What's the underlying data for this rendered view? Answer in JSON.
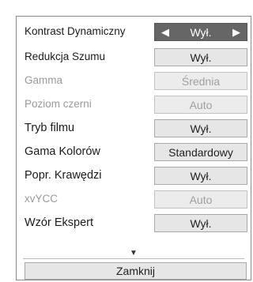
{
  "menu": {
    "rows": [
      {
        "label": "Kontrast Dynamiczny",
        "value": "Wył.",
        "state": "selected"
      },
      {
        "label": "Redukcja Szumu",
        "value": "Wył.",
        "state": "normal"
      },
      {
        "label": "Gamma",
        "value": "Średnia",
        "state": "disabled"
      },
      {
        "label": "Poziom czerni",
        "value": "Auto",
        "state": "disabled"
      },
      {
        "label": "Tryb filmu",
        "value": "Wył.",
        "state": "normal"
      },
      {
        "label": "Gama Kolorów",
        "value": "Standardowy",
        "state": "normal"
      },
      {
        "label": "Popr. Krawędzi",
        "value": "Wył.",
        "state": "normal"
      },
      {
        "label": "xvYCC",
        "value": "Auto",
        "state": "disabled"
      },
      {
        "label": "Wzór Ekspert",
        "value": "Wył.",
        "state": "normal"
      }
    ],
    "left_arrow": "◀",
    "right_arrow": "▶",
    "scroll_down": "▼",
    "close_label": "Zamknij"
  },
  "colors": {
    "selected_bg": "#666666",
    "value_bg": "#e6e6e6",
    "disabled_text": "#9a9a9a"
  }
}
